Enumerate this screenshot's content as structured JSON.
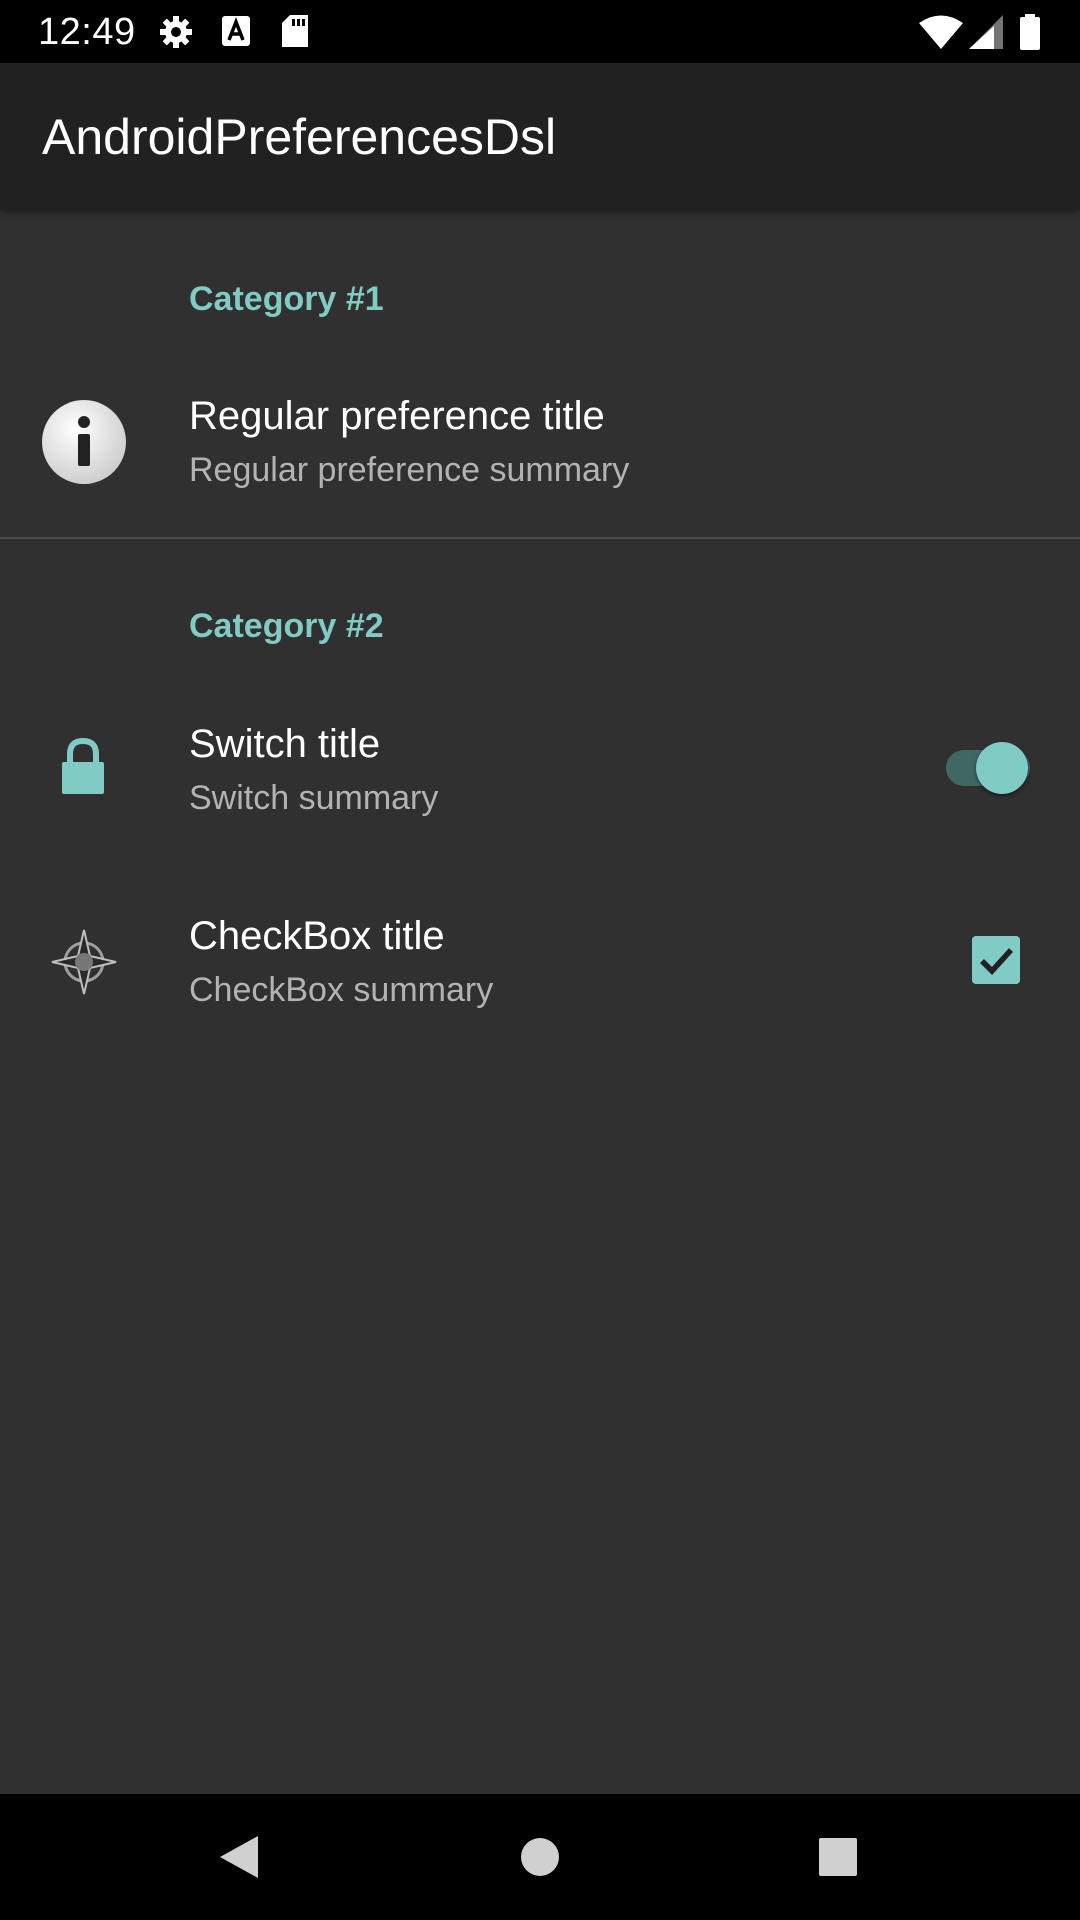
{
  "status_bar": {
    "time": "12:49",
    "left_icons": [
      "gear-icon",
      "a-keyboard-icon",
      "sd-card-icon"
    ],
    "right_icons": [
      "wifi-icon",
      "signal-icon",
      "battery-icon"
    ]
  },
  "app_bar": {
    "title": "AndroidPreferencesDsl"
  },
  "categories": [
    {
      "title": "Category #1",
      "items": [
        {
          "type": "regular",
          "icon": "info-icon",
          "title": "Regular preference title",
          "summary": "Regular preference summary"
        }
      ]
    },
    {
      "title": "Category #2",
      "items": [
        {
          "type": "switch",
          "icon": "lock-icon",
          "title": "Switch title",
          "summary": "Switch summary",
          "checked": true
        },
        {
          "type": "checkbox",
          "icon": "compass-icon",
          "title": "CheckBox title",
          "summary": "CheckBox summary",
          "checked": true
        }
      ]
    }
  ],
  "colors": {
    "accent": "#80cbc4",
    "background": "#303030",
    "app_bar": "#212121",
    "status_bar": "#000000"
  },
  "nav_bar": {
    "buttons": [
      "back-icon",
      "home-icon",
      "recents-icon"
    ]
  }
}
